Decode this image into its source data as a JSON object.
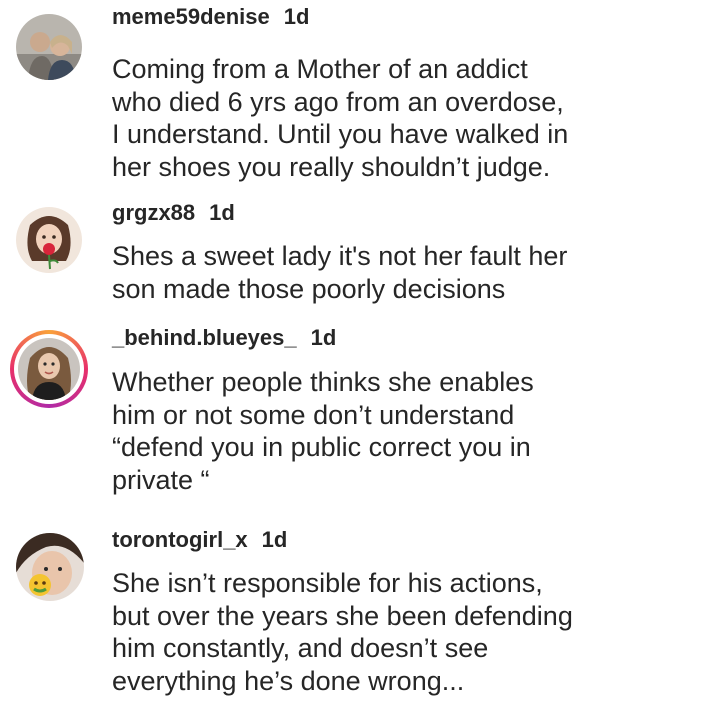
{
  "comments": [
    {
      "username": "meme59denise",
      "time": "1d",
      "lines": [
        "Coming from a Mother of an addict",
        "who died 6 yrs ago from an overdose,",
        "I understand. Until you have walked in",
        "her shoes you really shouldn’t judge."
      ],
      "avatar_icon": "couple-photo-avatar"
    },
    {
      "username": "grgzx88",
      "time": "1d",
      "lines": [
        "Shes a sweet lady it's not her fault her",
        "son made those poorly decisions"
      ],
      "avatar_icon": "woman-with-rose-avatar"
    },
    {
      "username": "_behind.blueyes_",
      "time": "1d",
      "lines": [
        "Whether people thinks she enables",
        "him or not some don’t understand",
        "“defend you in public correct you in",
        "private “"
      ],
      "avatar_icon": "woman-portrait-avatar",
      "has_story_ring": true
    },
    {
      "username": "torontogirl_x",
      "time": "1d",
      "lines": [
        "She isn’t responsible for his actions,",
        "but over the years she been defending",
        "him constantly, and doesn’t see",
        "everything he’s done wrong..."
      ],
      "avatar_icon": "selfie-with-emoji-avatar"
    }
  ],
  "colors": {
    "text": "#262626",
    "story_ring_start": "#f9a23a",
    "story_ring_end": "#b02aa6"
  }
}
